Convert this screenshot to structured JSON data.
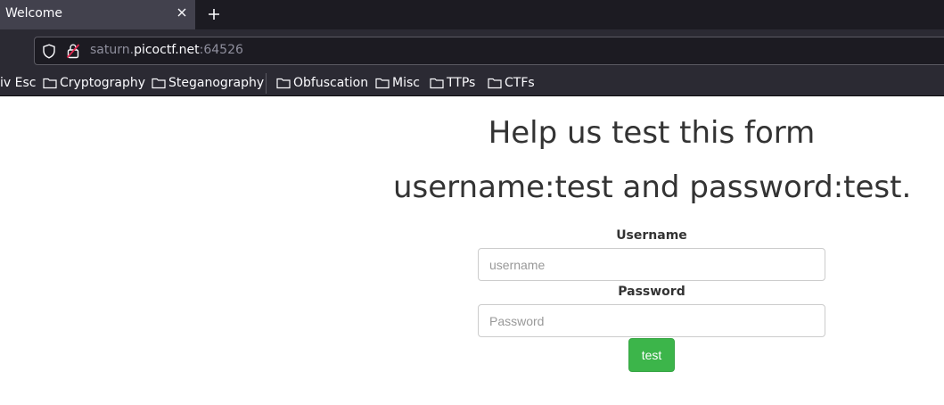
{
  "browser": {
    "tab": {
      "title": "Welcome"
    },
    "url": {
      "scheme_prefix": "saturn.",
      "host": "picoctf.net",
      "port": ":64526"
    },
    "bookmarks": [
      {
        "label": "iv Esc"
      },
      {
        "label": "Cryptography"
      },
      {
        "label": "Steganography"
      },
      {
        "label": "Obfuscation"
      },
      {
        "label": "Misc"
      },
      {
        "label": "TTPs"
      },
      {
        "label": "CTFs"
      }
    ]
  },
  "page": {
    "heading": "Help us test this form",
    "subheading": "username:test and password:test.",
    "form": {
      "username_label": "Username",
      "username_placeholder": "username",
      "username_value": "",
      "password_label": "Password",
      "password_placeholder": "Password",
      "password_value": "",
      "submit_label": "test"
    }
  },
  "colors": {
    "submit_button": "#3cb54a",
    "heading_text": "#333333",
    "chrome_dark": "#1c1b22",
    "chrome_toolbar": "#2b2a33"
  }
}
